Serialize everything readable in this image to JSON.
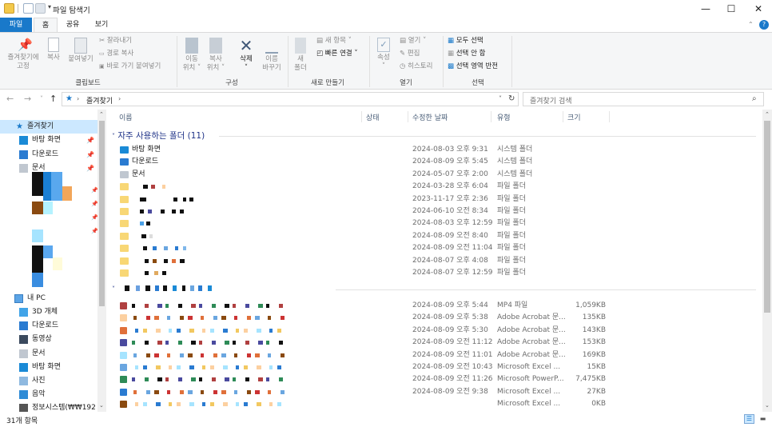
{
  "window": {
    "title": "파일 탐색기"
  },
  "tabs": {
    "file": "파일",
    "home": "홈",
    "share": "공유",
    "view": "보기"
  },
  "ribbon": {
    "pin": "즐겨찾기에\n고정",
    "copy": "복사",
    "paste": "붙여넣기",
    "cut": "잘라내기",
    "copy_path": "경로 복사",
    "paste_shortcut": "바로 가기 붙여넣기",
    "clipboard_group": "클립보드",
    "move_to": "이동\n위치 ˅",
    "copy_to": "복사\n위치 ˅",
    "delete": "삭제\n˅",
    "rename": "이름\n바꾸기",
    "organize_group": "구성",
    "new_folder": "새\n폴더",
    "new_item": "새 항목 ˅",
    "easy_access": "빠른 연결 ˅",
    "new_group": "새로 만들기",
    "properties": "속성\n˅",
    "open": "열기 ˅",
    "edit": "편집",
    "history": "히스토리",
    "open_group": "열기",
    "select_all": "모두 선택",
    "select_none": "선택 안 함",
    "invert_selection": "선택 영역 반전",
    "select_group": "선택"
  },
  "address": {
    "path": "즐겨찾기",
    "search_placeholder": "즐겨찾기 검색"
  },
  "nav": {
    "quick_access": "즐겨찾기",
    "pinned": [
      {
        "label": "바탕 화면",
        "icon": "desktop-icon"
      },
      {
        "label": "다운로드",
        "icon": "download-icon"
      },
      {
        "label": "문서",
        "icon": "document-icon"
      }
    ],
    "this_pc": "내 PC",
    "pc_items": [
      {
        "label": "3D 개체",
        "icon": "3d-objects-icon"
      },
      {
        "label": "다운로드",
        "icon": "download-icon"
      },
      {
        "label": "동영상",
        "icon": "video-icon"
      },
      {
        "label": "문서",
        "icon": "document-icon"
      },
      {
        "label": "바탕 화면",
        "icon": "desktop-icon"
      },
      {
        "label": "사진",
        "icon": "pictures-icon"
      },
      {
        "label": "음악",
        "icon": "music-icon"
      },
      {
        "label": "정보시스템(₩₩192",
        "icon": "network-drive-icon"
      }
    ]
  },
  "columns": {
    "name": "이름",
    "status": "상태",
    "date": "수정한 날짜",
    "type": "유형",
    "size": "크기"
  },
  "groups": {
    "frequent": "자주 사용하는 폴더 (11)"
  },
  "frequent_rows": [
    {
      "name": "바탕 화면",
      "icon": "desktop-icon",
      "date": "2024-08-03 오후 9:31",
      "type": "시스템 폴더"
    },
    {
      "name": "다운로드",
      "icon": "download-icon",
      "date": "2024-08-09 오후 5:45",
      "type": "시스템 폴더"
    },
    {
      "name": "문서",
      "icon": "document-icon",
      "date": "2024-05-07 오후 2:00",
      "type": "시스템 폴더"
    },
    {
      "name": "",
      "icon": "folder-icon",
      "date": "2024-03-28 오후 6:04",
      "type": "파일 폴더"
    },
    {
      "name": "",
      "icon": "folder-icon",
      "date": "2023-11-17 오후 2:36",
      "type": "파일 폴더"
    },
    {
      "name": "",
      "icon": "folder-icon",
      "date": "2024-06-10 오전 8:34",
      "type": "파일 폴더"
    },
    {
      "name": "",
      "icon": "folder-icon",
      "date": "2024-08-03 오후 12:59",
      "type": "파일 폴더"
    },
    {
      "name": "",
      "icon": "folder-icon",
      "date": "2024-08-09 오전 8:40",
      "type": "파일 폴더"
    },
    {
      "name": "",
      "icon": "folder-icon",
      "date": "2024-08-09 오전 11:04",
      "type": "파일 폴더"
    },
    {
      "name": "",
      "icon": "folder-icon",
      "date": "2024-08-07 오후 4:08",
      "type": "파일 폴더"
    },
    {
      "name": "",
      "icon": "folder-icon",
      "date": "2024-08-07 오후 12:59",
      "type": "파일 폴더"
    }
  ],
  "recent_rows": [
    {
      "date": "2024-08-09 오후 5:44",
      "type": "MP4 파일",
      "size": "1,059KB"
    },
    {
      "date": "2024-08-09 오후 5:38",
      "type": "Adobe Acrobat 문...",
      "size": "135KB"
    },
    {
      "date": "2024-08-09 오후 5:30",
      "type": "Adobe Acrobat 문...",
      "size": "143KB"
    },
    {
      "date": "2024-08-09 오전 11:12",
      "type": "Adobe Acrobat 문...",
      "size": "153KB"
    },
    {
      "date": "2024-08-09 오전 11:01",
      "type": "Adobe Acrobat 문...",
      "size": "169KB"
    },
    {
      "date": "2024-08-09 오전 10:43",
      "type": "Microsoft Excel ...",
      "size": "15KB"
    },
    {
      "date": "2024-08-09 오전 11:26",
      "type": "Microsoft PowerP...",
      "size": "7,475KB"
    },
    {
      "date": "2024-08-09 오전 9:38",
      "type": "Microsoft Excel ...",
      "size": "27KB"
    },
    {
      "date": "",
      "type": "Microsoft Excel ...",
      "size": "0KB"
    }
  ],
  "status": {
    "count": "31개 항목"
  },
  "colors": {
    "accent": "#1979ca",
    "folder": "#f8d775",
    "selection": "#cce8ff",
    "group_header": "#1e3287"
  }
}
